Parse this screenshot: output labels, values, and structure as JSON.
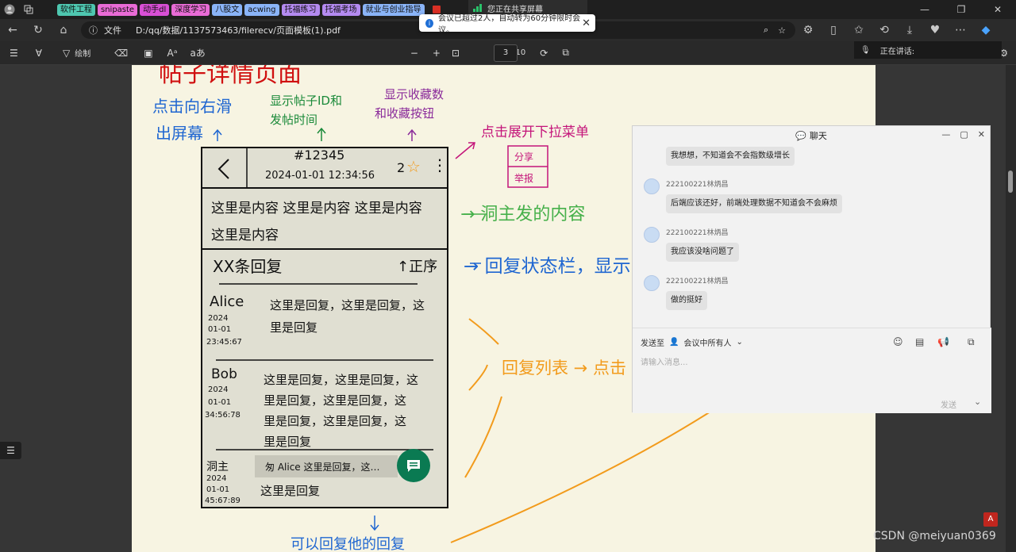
{
  "tabs": {
    "chips": [
      {
        "label": "软件工程",
        "color": "#4ec7b0"
      },
      {
        "label": "snipaste",
        "color": "#e96bd6"
      },
      {
        "label": "动手dl",
        "color": "#d94fd6"
      },
      {
        "label": "深度学习",
        "color": "#e96bd6"
      },
      {
        "label": "八股文",
        "color": "#8ab4f8"
      },
      {
        "label": "acwing",
        "color": "#8ab4f8"
      },
      {
        "label": "托福练习",
        "color": "#b48af0"
      },
      {
        "label": "托福考场",
        "color": "#b48af0"
      },
      {
        "label": "就业与创业指导",
        "color": "#8ab4f8"
      }
    ],
    "sharing_status": "您正在共享屏幕"
  },
  "notice": {
    "text": "会议已超过2人，自动转为60分钟限时会议。"
  },
  "address": {
    "file_label": "文件",
    "url": "D:/qq/数据/1137573463/filerecv/页面模板(1).pdf"
  },
  "pdf_toolbar": {
    "draw_label": "绘制",
    "current_page": "3",
    "total_pages": "/ 10"
  },
  "speaker": {
    "label": "正在讲话:"
  },
  "drawing": {
    "title_fragment": "帖子详情页面",
    "note_back": [
      "点击向右滑",
      "出屏幕"
    ],
    "note_id": [
      "显示帖子ID和",
      "发帖时间"
    ],
    "note_fav": [
      "显示收藏数",
      "和收藏按钮"
    ],
    "note_menu": "点击展开下拉菜单",
    "menu_share": "分享",
    "menu_report": "举报",
    "post_id": "#12345",
    "post_time": "2024-01-01  12:34:56",
    "fav_count": "2",
    "content_line1": "这里是内容 这里是内容 这里是内容",
    "content_line2": "这里是内容",
    "note_content": "→ 洞主发的内容",
    "reply_count": "XX条回复",
    "sort_label": "↑正序",
    "note_status": "→ 回复状态栏，显示",
    "alice_name": "Alice",
    "alice_date": [
      "2024",
      "01-01",
      "23:45:67"
    ],
    "alice_reply": [
      "这里是回复，这里是回复，这",
      "里是回复"
    ],
    "bob_name": "Bob",
    "bob_date": [
      "2024",
      "01-01",
      "34:56:78"
    ],
    "bob_reply": [
      "这里是回复，这里是回复，这",
      "里是回复，这里是回复，这",
      "里是回复，这里是回复，这",
      "里是回复"
    ],
    "host_name": "洞主",
    "host_date": [
      "2024",
      "01-01",
      "45:67:89"
    ],
    "host_quote": "匆 Alice 这里是回复，这…",
    "host_reply": "这里是回复",
    "note_list": "回复列表 → 点击",
    "bottom_note": "可以回复他的回复"
  },
  "chat": {
    "title": "聊天",
    "messages": [
      {
        "sender": "",
        "text": "我想想，不知道会不会指数级增长"
      },
      {
        "sender": "222100221林炳昌",
        "text": "后端应该还好，前端处理数据不知道会不会麻烦"
      },
      {
        "sender": "222100221林炳昌",
        "text": "我应该没啥问题了"
      },
      {
        "sender": "222100221林炳昌",
        "text": "做的挺好"
      }
    ],
    "send_to_label": "发送至",
    "send_to_value": "会议中所有人",
    "input_placeholder": "请输入消息...",
    "send_button": "发送"
  },
  "watermark": "CSDN @meiyuan0369"
}
